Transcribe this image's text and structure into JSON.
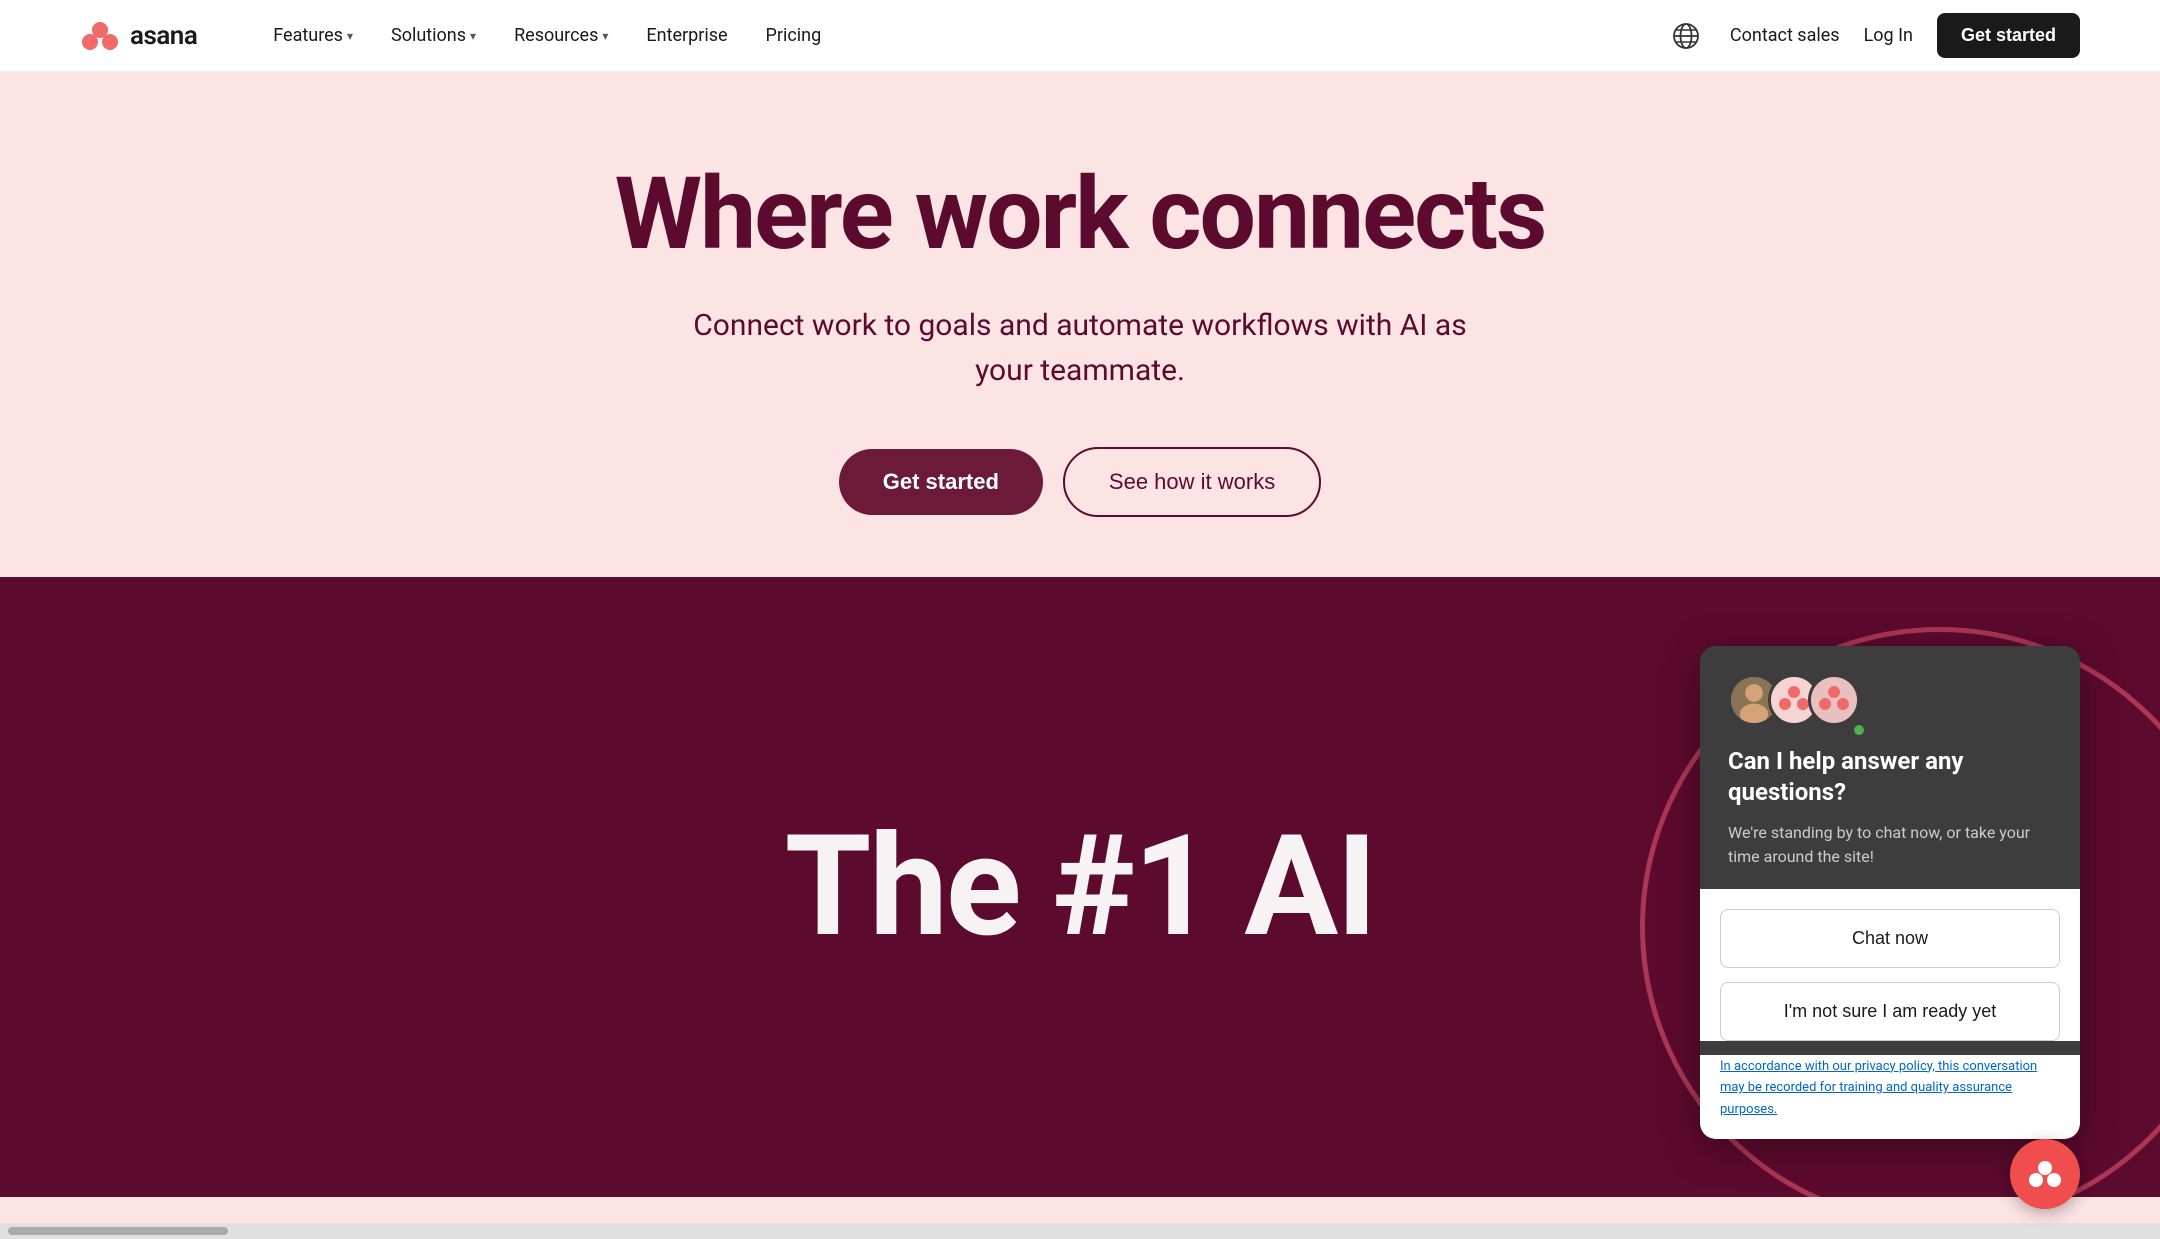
{
  "navbar": {
    "logo_text": "asana",
    "nav_items": [
      {
        "label": "Features",
        "has_dropdown": true
      },
      {
        "label": "Solutions",
        "has_dropdown": true
      },
      {
        "label": "Resources",
        "has_dropdown": true
      },
      {
        "label": "Enterprise",
        "has_dropdown": false
      },
      {
        "label": "Pricing",
        "has_dropdown": false
      }
    ],
    "contact_sales": "Contact sales",
    "login": "Log In",
    "get_started": "Get started"
  },
  "hero": {
    "title": "Where work connects",
    "subtitle": "Connect work to goals and automate workflows with AI as your teammate.",
    "btn_get_started": "Get started",
    "btn_see_how": "See how it works",
    "video_text": "The #1 AI"
  },
  "chat_widget": {
    "title": "Can I help answer any questions?",
    "subtitle": "We're standing by to chat now, or take your time around the site!",
    "btn_chat_now": "Chat now",
    "btn_not_ready": "I'm not sure I am ready yet",
    "privacy_text": "In accordance with our privacy policy, this conversation may be recorded for training and quality assurance purposes."
  },
  "icons": {
    "globe": "🌐",
    "asana_dots": "⬤"
  }
}
